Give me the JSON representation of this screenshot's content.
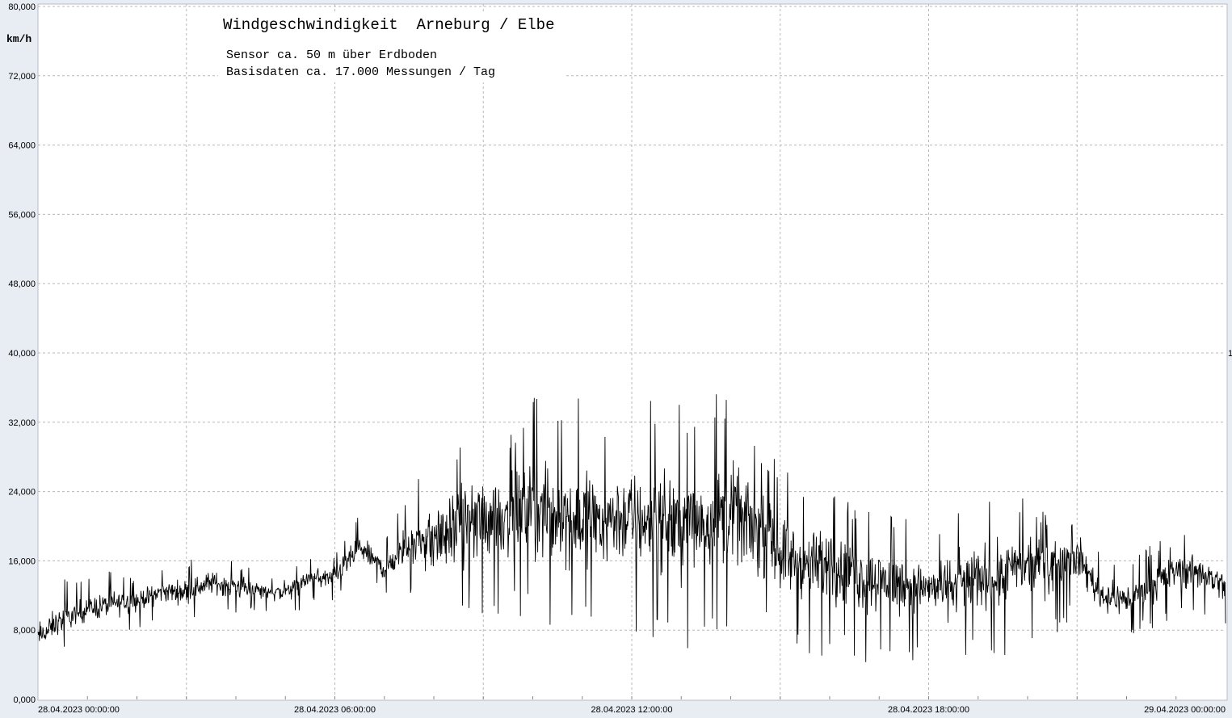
{
  "chart_data": {
    "type": "line",
    "title": "Windgeschwindigkeit  Arneburg / Elbe",
    "subtitle_lines": [
      "Sensor ca. 50 m über Erdboden",
      "Basisdaten ca. 17.000 Messungen / Tag"
    ],
    "ylabel": "km/h",
    "ylim": [
      0,
      80
    ],
    "yticks": [
      0,
      8,
      16,
      24,
      32,
      40,
      48,
      56,
      64,
      72,
      80
    ],
    "ytick_labels": [
      "0,000",
      "8,000",
      "16,000",
      "24,000",
      "32,000",
      "40,000",
      "48,000",
      "56,000",
      "64,000",
      "72,000",
      "80,000"
    ],
    "xlim_hours": [
      0,
      24
    ],
    "xticks_hours": [
      0,
      6,
      12,
      18,
      24
    ],
    "xtick_labels": [
      "28.04.2023  00:00:00",
      "28.04.2023  06:00:00",
      "28.04.2023  12:00:00",
      "28.04.2023  18:00:00",
      "29.04.2023  00:00:00"
    ],
    "right_edge_label": "1",
    "grid": true,
    "series": [
      {
        "color": "#000000",
        "x_hours": [
          0,
          0.5,
          1,
          1.5,
          2,
          2.5,
          3,
          3.5,
          4,
          4.5,
          5,
          5.5,
          6,
          6.5,
          7,
          7.5,
          8,
          8.5,
          9,
          9.5,
          10,
          10.5,
          11,
          11.5,
          12,
          12.5,
          13,
          13.5,
          14,
          14.5,
          15,
          15.5,
          16,
          16.5,
          17,
          17.5,
          18,
          18.5,
          19,
          19.5,
          20,
          20.5,
          21,
          21.5,
          22,
          22.5,
          23,
          23.5,
          24
        ],
        "mean": [
          7,
          9,
          10.5,
          11,
          11.5,
          12.5,
          12.5,
          13.5,
          13,
          12.5,
          12.5,
          14,
          14,
          17.5,
          15,
          18,
          18.5,
          20,
          21,
          21.5,
          22,
          21.5,
          21,
          21,
          21,
          20.5,
          20.5,
          21,
          21.5,
          20,
          17,
          15.5,
          15.5,
          14.5,
          14,
          13.5,
          13,
          13,
          14,
          14.5,
          15.5,
          16,
          17,
          12,
          11.5,
          13,
          15,
          15,
          13
        ],
        "min": [
          5,
          6,
          7,
          7,
          8,
          9,
          9,
          10,
          10,
          10,
          9,
          11,
          11,
          14,
          12,
          11,
          9,
          8,
          8,
          9,
          8,
          7,
          8,
          8,
          7,
          6,
          5,
          6,
          7,
          7,
          6,
          5,
          5,
          4,
          4,
          4,
          4,
          5,
          5,
          5,
          6,
          7,
          9,
          7,
          7,
          8,
          9,
          9,
          8
        ],
        "max": [
          12,
          14,
          14,
          15,
          14,
          15,
          16,
          17,
          16,
          15,
          14,
          17,
          17,
          21.5,
          18,
          25,
          27,
          30,
          33,
          32,
          35,
          34,
          35,
          34,
          35,
          35,
          34,
          35,
          36,
          30,
          28,
          25,
          26,
          22,
          22,
          21,
          19,
          22,
          24,
          24,
          23,
          21,
          20,
          17,
          16,
          18,
          19,
          19,
          17
        ]
      }
    ]
  }
}
